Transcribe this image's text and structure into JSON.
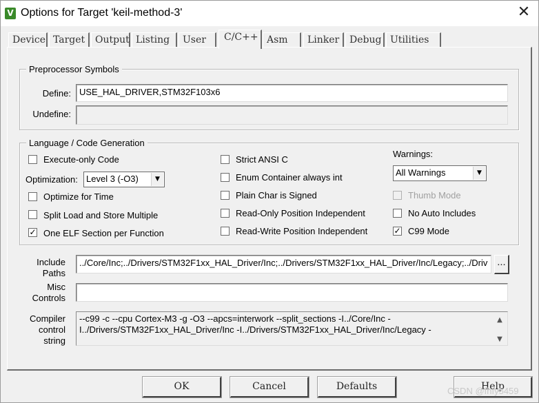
{
  "window": {
    "icon_glyph": "V",
    "title": "Options for Target 'keil-method-3'",
    "close_glyph": "✕"
  },
  "tabs": [
    {
      "label": "Device",
      "active": false
    },
    {
      "label": "Target",
      "active": false
    },
    {
      "label": "Output",
      "active": false
    },
    {
      "label": "Listing",
      "active": false
    },
    {
      "label": "User",
      "active": false
    },
    {
      "label": "C/C++",
      "active": true
    },
    {
      "label": "Asm",
      "active": false
    },
    {
      "label": "Linker",
      "active": false
    },
    {
      "label": "Debug",
      "active": false
    },
    {
      "label": "Utilities",
      "active": false
    }
  ],
  "preprocessor": {
    "title": "Preprocessor Symbols",
    "define_label": "Define:",
    "define_value": "USE_HAL_DRIVER,STM32F103x6",
    "undefine_label": "Undefine:",
    "undefine_value": ""
  },
  "codegen": {
    "title": "Language / Code Generation",
    "execute_only": {
      "label": "Execute-only Code",
      "checked": false
    },
    "optimization_label": "Optimization:",
    "optimization_value": "Level 3 (-O3)",
    "optimize_time": {
      "label": "Optimize for Time",
      "checked": false
    },
    "split_load": {
      "label": "Split Load and Store Multiple",
      "checked": false
    },
    "one_elf": {
      "label": "One ELF Section per Function",
      "checked": true
    },
    "strict_ansi": {
      "label": "Strict ANSI C",
      "checked": false
    },
    "enum_container": {
      "label": "Enum Container always int",
      "checked": false
    },
    "plain_char": {
      "label": "Plain Char is Signed",
      "checked": false
    },
    "ro_position": {
      "label": "Read-Only Position Independent",
      "checked": false
    },
    "rw_position": {
      "label": "Read-Write Position Independent",
      "checked": false
    },
    "warnings_label": "Warnings:",
    "warnings_value": "All Warnings",
    "thumb_mode": {
      "label": "Thumb Mode",
      "checked": false,
      "disabled": true
    },
    "no_auto_includes": {
      "label": "No Auto Includes",
      "checked": false
    },
    "c99_mode": {
      "label": "C99 Mode",
      "checked": true
    }
  },
  "paths": {
    "include_label_1": "Include",
    "include_label_2": "Paths",
    "include_value": "../Core/Inc;../Drivers/STM32F1xx_HAL_Driver/Inc;../Drivers/STM32F1xx_HAL_Driver/Inc/Legacy;../Driv",
    "browse_label": "...",
    "misc_label_1": "Misc",
    "misc_label_2": "Controls",
    "misc_value": "",
    "compiler_label_1": "Compiler",
    "compiler_label_2": "control",
    "compiler_label_3": "string",
    "compiler_line_1": "--c99 -c --cpu Cortex-M3 -g -O3 --apcs=interwork --split_sections -I../Core/Inc -",
    "compiler_line_2": "I../Drivers/STM32F1xx_HAL_Driver/Inc -I../Drivers/STM32F1xx_HAL_Driver/Inc/Legacy -"
  },
  "buttons": {
    "ok": "OK",
    "cancel": "Cancel",
    "defaults": "Defaults",
    "help": "Help"
  },
  "watermark": "CSDN @fhfy5459",
  "check_glyph": "✓",
  "icons": {
    "dropdown": "chevron-down-icon",
    "scroll_up": "scroll-up-icon",
    "scroll_down": "scroll-down-icon"
  }
}
